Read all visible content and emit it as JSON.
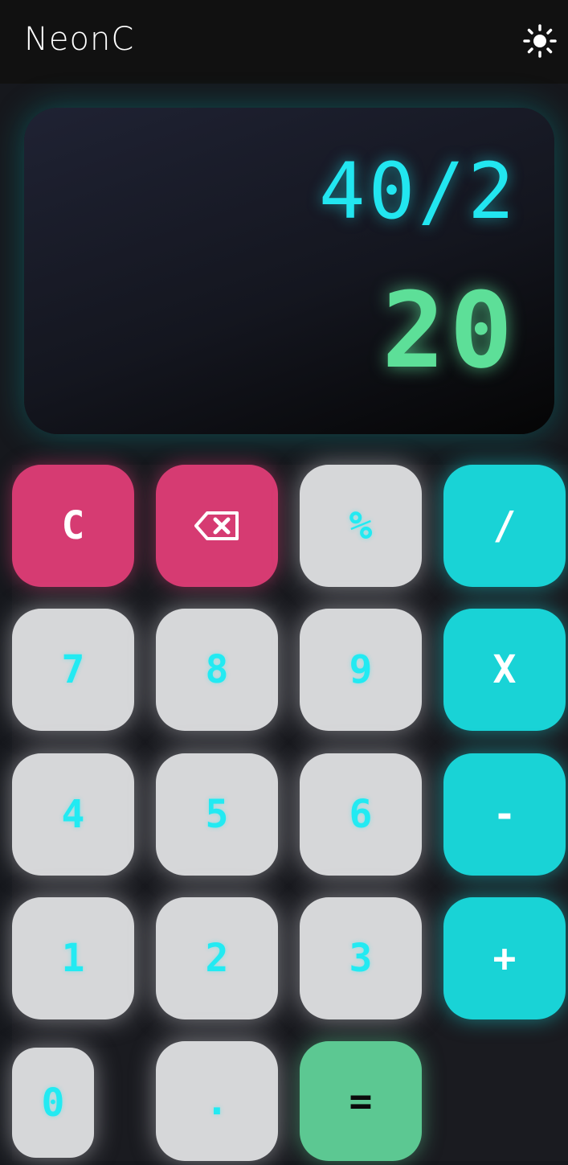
{
  "header": {
    "title": "NeonC",
    "theme_icon": "sun-icon"
  },
  "display": {
    "expression": "40/2",
    "result": "20"
  },
  "keypad": {
    "clear": "C",
    "backspace_icon": "backspace-icon",
    "percent": "%",
    "divide": "/",
    "seven": "7",
    "eight": "8",
    "nine": "9",
    "multiply": "X",
    "four": "4",
    "five": "5",
    "six": "6",
    "minus": "-",
    "one": "1",
    "two": "2",
    "three": "3",
    "plus": "+",
    "zero": "0",
    "decimal": ".",
    "equals": "="
  },
  "colors": {
    "header_bg": "#111111",
    "page_bg": "#16181d",
    "expression_text": "#22e6f0",
    "result_text": "#5ddf98",
    "number_key": "#d6d7d9",
    "clear_key": "#d63b72",
    "operator_key": "#19d3d6",
    "equals_key": "#5cc892"
  }
}
